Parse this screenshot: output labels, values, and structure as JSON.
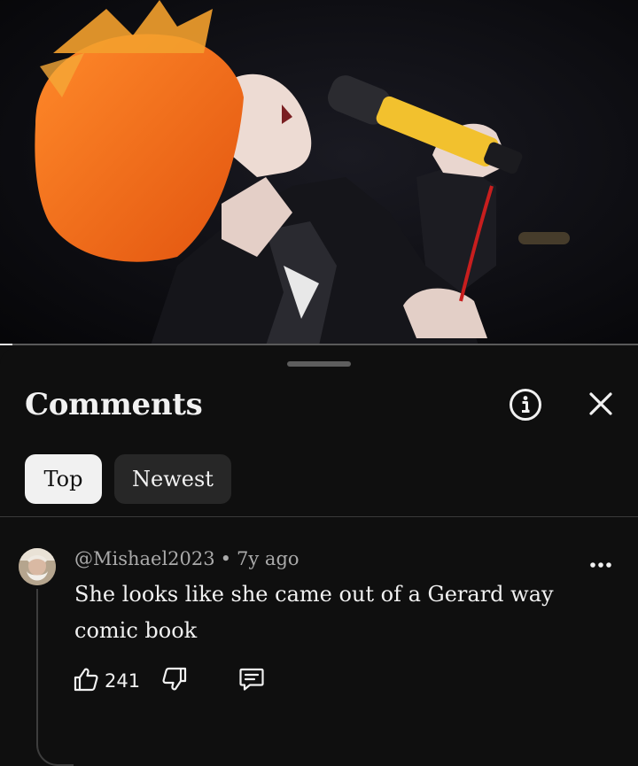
{
  "video": {
    "progress_fraction": 0.02
  },
  "sheet": {
    "title": "Comments",
    "info_icon": "info-circle-icon",
    "close_icon": "close-icon",
    "filters": [
      {
        "label": "Top",
        "selected": true
      },
      {
        "label": "Newest",
        "selected": false
      }
    ]
  },
  "comments": [
    {
      "author": "@Mishael2023",
      "separator": "•",
      "age": "7y ago",
      "text": "She looks like she came out of a Gerard way comic book",
      "likes": "241",
      "icons": {
        "like": "thumbs-up-icon",
        "dislike": "thumbs-down-icon",
        "reply": "reply-icon",
        "more": "more-vertical-icon"
      }
    }
  ],
  "colors": {
    "background": "#0f0f0f",
    "chip_selected_bg": "#f1f1f1",
    "chip_bg": "#272727",
    "secondary_text": "#aaaaaa",
    "hair_orange": "#f26a1b",
    "mic_yellow": "#f2c12e"
  }
}
